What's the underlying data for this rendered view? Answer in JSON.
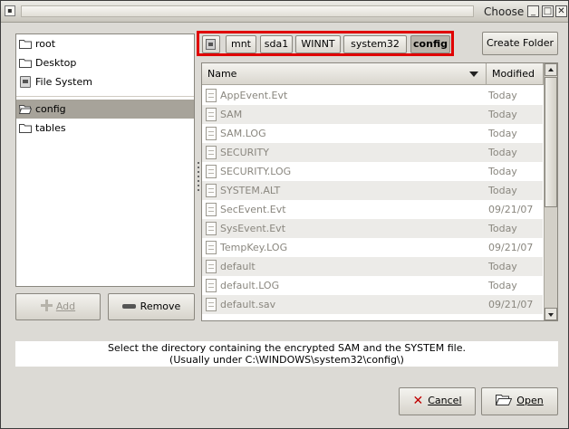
{
  "window": {
    "title": "Choose",
    "menu_glyph": "▪",
    "minimize_glyph": "_",
    "maximize_glyph": "□",
    "close_glyph": "✕"
  },
  "places": [
    {
      "label": "root",
      "icon": "folder-icon"
    },
    {
      "label": "Desktop",
      "icon": "folder-icon"
    },
    {
      "label": "File System",
      "icon": "disk-icon"
    },
    {
      "label": "config",
      "icon": "folder-open-icon",
      "selected": true
    },
    {
      "label": "tables",
      "icon": "folder-icon"
    }
  ],
  "buttons": {
    "add": "Add",
    "remove": "Remove",
    "create_folder": "Create Folder",
    "cancel": "Cancel",
    "open": "Open"
  },
  "path": [
    "mnt",
    "sda1",
    "WINNT",
    "system32",
    "config"
  ],
  "columns": {
    "name": "Name",
    "modified": "Modified"
  },
  "files": [
    {
      "name": "AppEvent.Evt",
      "modified": "Today"
    },
    {
      "name": "SAM",
      "modified": "Today"
    },
    {
      "name": "SAM.LOG",
      "modified": "Today"
    },
    {
      "name": "SECURITY",
      "modified": "Today"
    },
    {
      "name": "SECURITY.LOG",
      "modified": "Today"
    },
    {
      "name": "SYSTEM.ALT",
      "modified": "Today"
    },
    {
      "name": "SecEvent.Evt",
      "modified": "09/21/07"
    },
    {
      "name": "SysEvent.Evt",
      "modified": "Today"
    },
    {
      "name": "TempKey.LOG",
      "modified": "09/21/07"
    },
    {
      "name": "default",
      "modified": "Today"
    },
    {
      "name": "default.LOG",
      "modified": "Today"
    },
    {
      "name": "default.sav",
      "modified": "09/21/07"
    }
  ],
  "message": {
    "line1": "Select the directory containing the encrypted SAM and the SYSTEM file.",
    "line2": "(Usually under C:\\WINDOWS\\system32\\config\\)"
  },
  "colors": {
    "highlight_border": "#e00000",
    "selection": "#a7a39a"
  }
}
